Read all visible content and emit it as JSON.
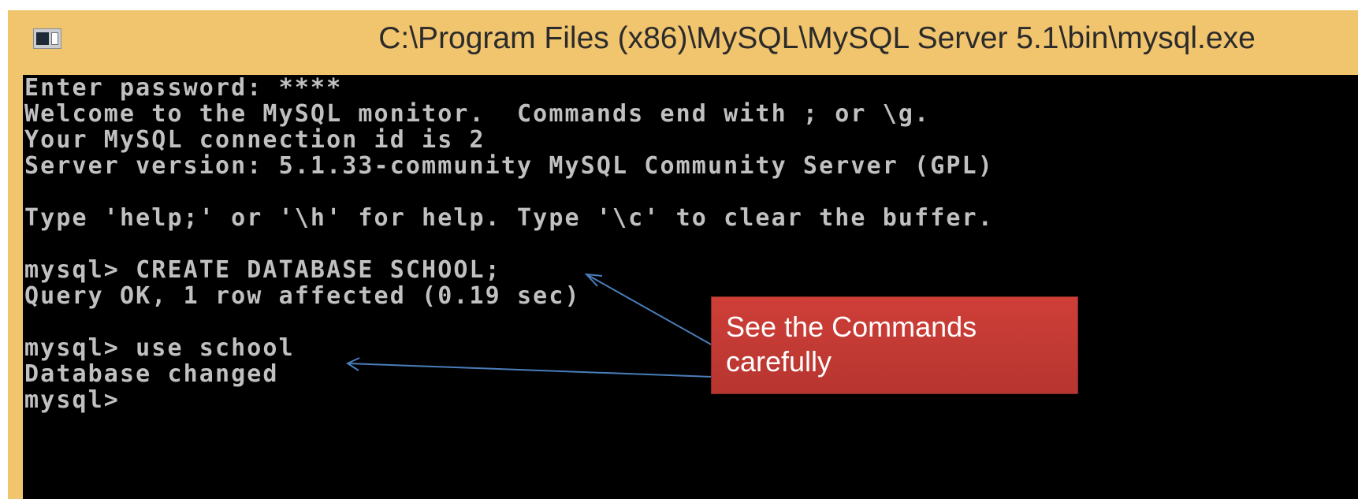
{
  "window": {
    "title": "C:\\Program Files (x86)\\MySQL\\MySQL Server 5.1\\bin\\mysql.exe",
    "icon": "console-window-icon"
  },
  "console": {
    "lines": [
      "Enter password: ****",
      "Welcome to the MySQL monitor.  Commands end with ; or \\g.",
      "Your MySQL connection id is 2",
      "Server version: 5.1.33-community MySQL Community Server (GPL)",
      "",
      "Type 'help;' or '\\h' for help. Type '\\c' to clear the buffer.",
      "",
      "mysql> CREATE DATABASE SCHOOL;",
      "Query OK, 1 row affected (0.19 sec)",
      "",
      "mysql> use school",
      "Database changed",
      "mysql>"
    ]
  },
  "callout": {
    "line1": "See the Commands",
    "line2": "carefully",
    "color": "#C0392B"
  },
  "colors": {
    "frame": "#F1C46E",
    "console_bg": "#000000",
    "console_text": "#C0C0C0",
    "arrow": "#4A7EBB"
  }
}
